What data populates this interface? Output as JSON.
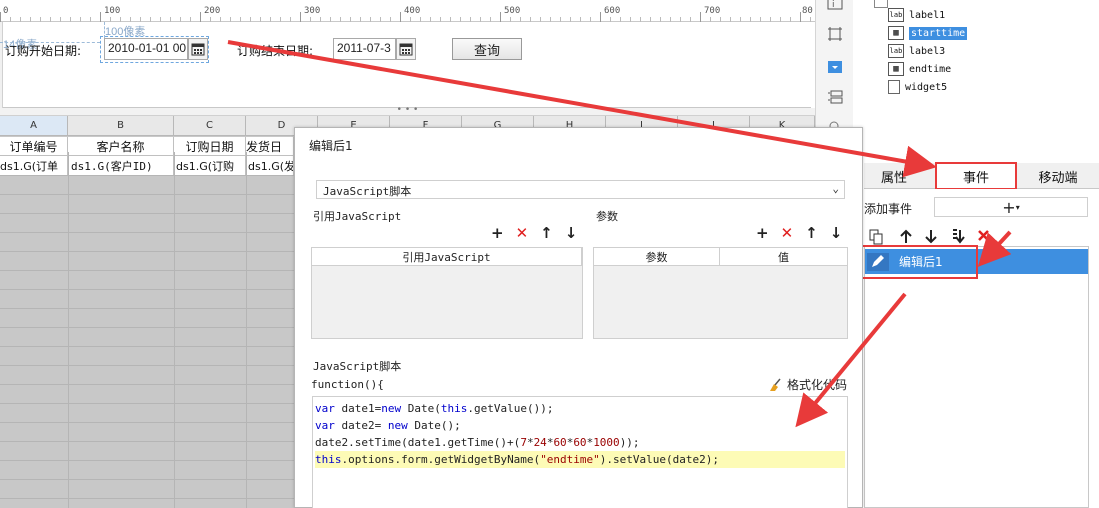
{
  "ruler": {
    "marks": [
      "0",
      "100",
      "200",
      "300",
      "400",
      "500",
      "600",
      "700",
      "80"
    ]
  },
  "form": {
    "start_label": "订购开始日期:",
    "start_value": "2010-01-01 00",
    "end_label": "订购结束日期:",
    "end_value": "2011-07-3",
    "query_label": "查询",
    "hint_left": "14像素",
    "hint_top": "100像素"
  },
  "sheet": {
    "columns": [
      "A",
      "B",
      "C",
      "D",
      "E",
      "F",
      "G",
      "H",
      "I",
      "J",
      "K"
    ],
    "headers": [
      "订单编号",
      "客户名称",
      "订购日期",
      "发货日"
    ],
    "cells": [
      "ds1.G(订单",
      "ds1.G(客户ID)",
      "ds1.G(订购",
      "ds1.G(发"
    ]
  },
  "tree": {
    "items": [
      {
        "label": "label1",
        "icon": "lab"
      },
      {
        "label": "starttime",
        "icon": "cal"
      },
      {
        "label": "label3",
        "icon": "lab"
      },
      {
        "label": "endtime",
        "icon": "cal"
      },
      {
        "label": "widget5",
        "icon": "doc"
      }
    ]
  },
  "panel": {
    "tabs": [
      "属性",
      "事件",
      "移动端"
    ],
    "add_event_label": "添加事件",
    "add_symbol": "+",
    "event_item": "编辑后1"
  },
  "dialog": {
    "title": "编辑后1",
    "script_type": "JavaScript脚本",
    "ref_js_label": "引用JavaScript",
    "params_label": "参数",
    "ref_js_col": "引用JavaScript",
    "param_col": "参数",
    "value_col": "值",
    "script_section": "JavaScript脚本",
    "function_sig": "function(){",
    "format_button": "格式化代码",
    "code": [
      "var date1=new Date(this.getValue());",
      "var date2= new Date();",
      "date2.setTime(date1.getTime()+(7*24*60*60*1000));",
      "this.options.form.getWidgetByName(\"endtime\").setValue(date2);"
    ]
  },
  "colors": {
    "accent": "#3e8fe0",
    "annotation": "#e83a3a",
    "highlight": "#fdfbb6"
  }
}
